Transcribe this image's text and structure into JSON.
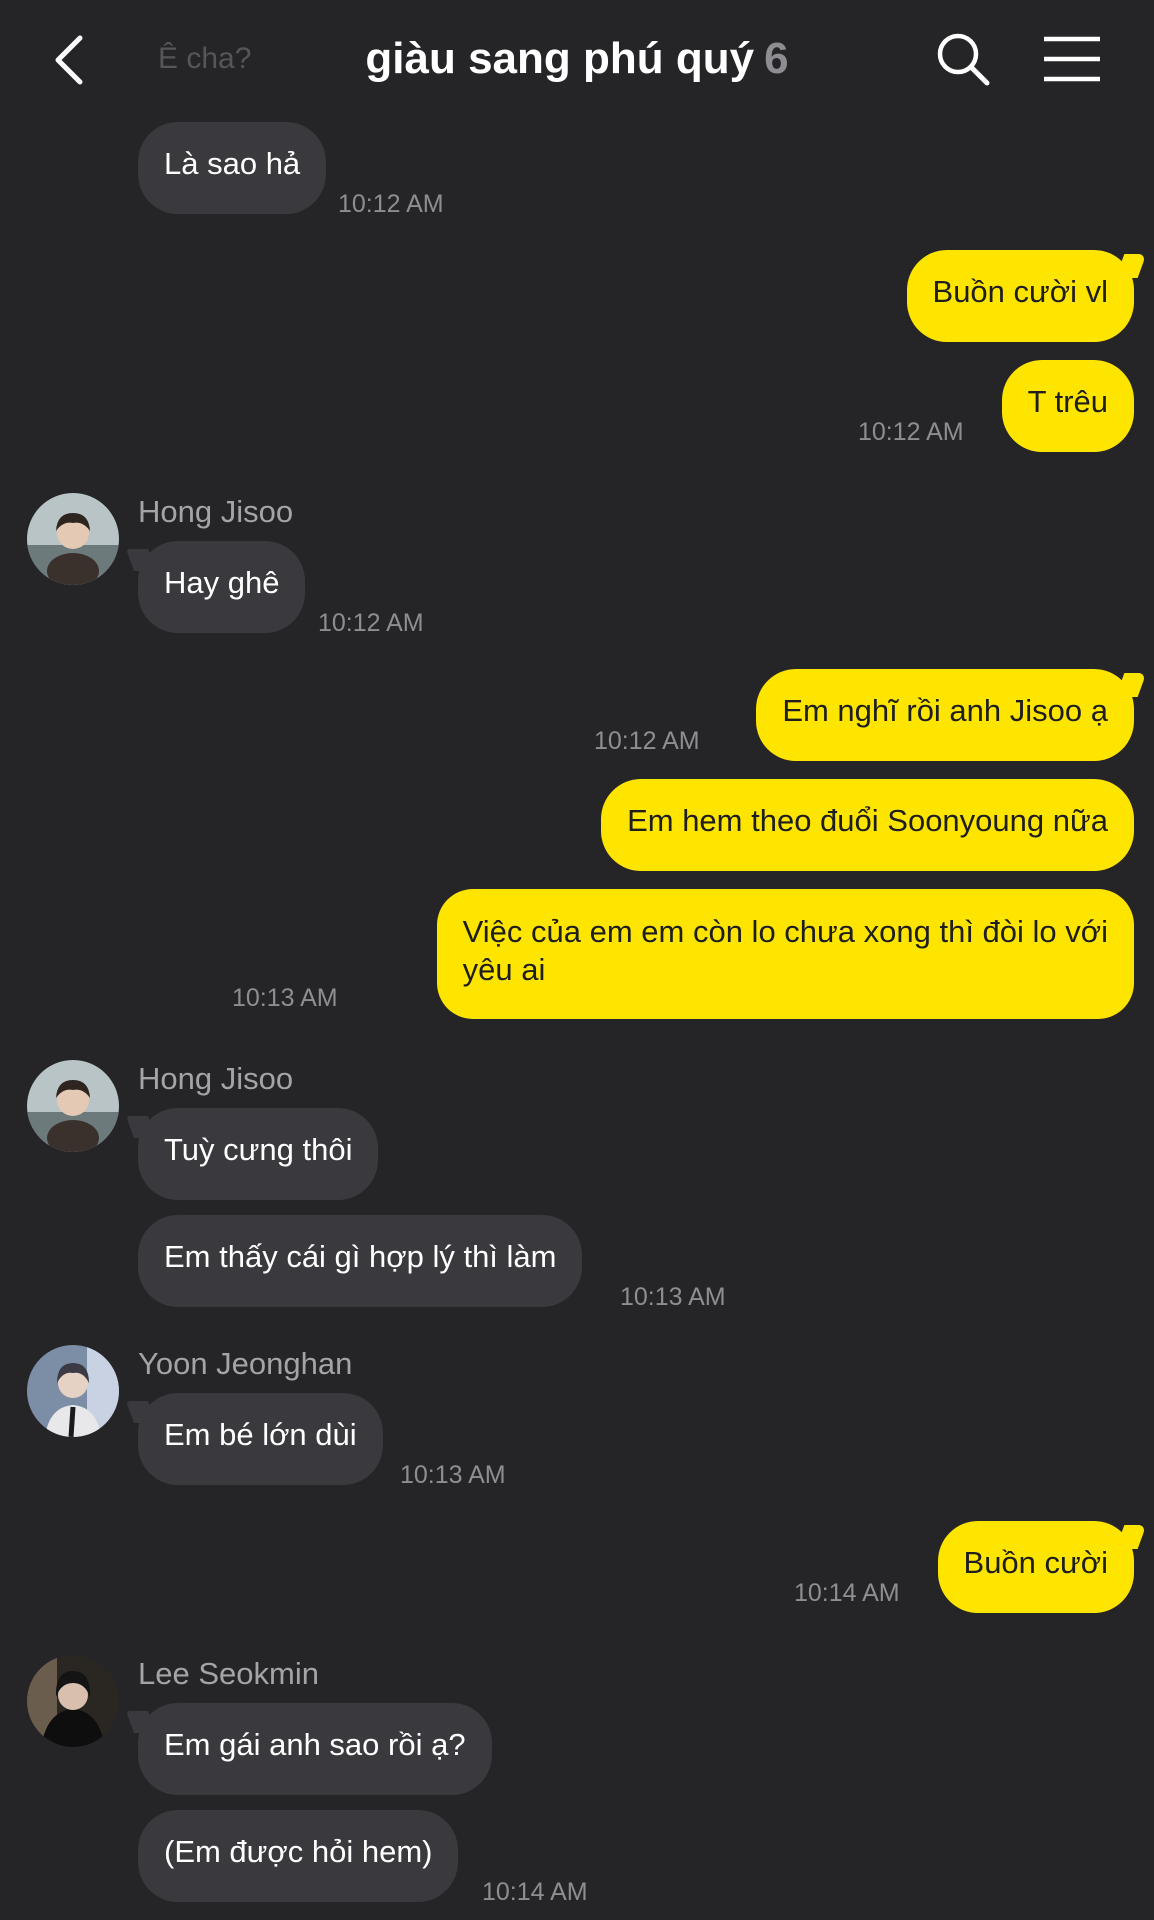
{
  "header": {
    "title": "giàu sang phú quý",
    "member_count": "6",
    "ghost_text": "Ê cha?"
  },
  "messages": {
    "m1": {
      "text": "Là sao hả",
      "time": "10:12 AM"
    },
    "m2": {
      "text": "Buồn cười vl"
    },
    "m3": {
      "text": "T trêu",
      "time": "10:12 AM"
    },
    "m4": {
      "sender": "Hong Jisoo",
      "text": "Hay ghê",
      "time": "10:12 AM"
    },
    "m5": {
      "text": "Em nghĩ rồi anh Jisoo ạ",
      "time": "10:12 AM"
    },
    "m6": {
      "text": "Em hem theo đuổi Soonyoung nữa"
    },
    "m7": {
      "text_line1": "Việc của em em còn lo chưa xong thì đòi lo với",
      "text_line2": "yêu ai",
      "time": "10:13 AM"
    },
    "m8": {
      "sender": "Hong Jisoo",
      "text": "Tuỳ cưng thôi"
    },
    "m9": {
      "text": "Em thấy cái gì hợp lý thì làm",
      "time": "10:13 AM"
    },
    "m10": {
      "sender": "Yoon Jeonghan",
      "text": "Em bé lớn dùi",
      "time": "10:13 AM"
    },
    "m11": {
      "text": "Buồn cười",
      "time": "10:14 AM"
    },
    "m12": {
      "sender": "Lee Seokmin",
      "text": "Em gái anh sao rồi ạ?"
    },
    "m13": {
      "text": "(Em được hỏi hem)",
      "time": "10:14 AM"
    }
  },
  "colors": {
    "background": "#252528",
    "incoming_bubble": "#3a3a3e",
    "outgoing_bubble": "#fee500",
    "timestamp": "#8d8d92"
  },
  "icons": {
    "back": "back-icon",
    "search": "search-icon",
    "menu": "menu-icon"
  }
}
